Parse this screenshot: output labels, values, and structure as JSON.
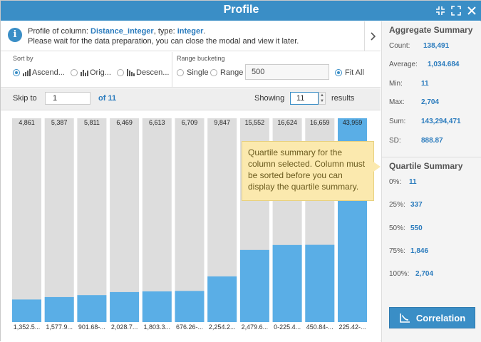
{
  "window": {
    "title": "Profile"
  },
  "info": {
    "prefix": "Profile of column: ",
    "column": "Distance_integer",
    "type_prefix": ", type: ",
    "type": "integer",
    "suffix": ".",
    "line2": "Please wait for the data preparation, you can close the modal and view it later."
  },
  "sort": {
    "label": "Sort by",
    "options": [
      "Ascend...",
      "Orig...",
      "Descen..."
    ]
  },
  "range": {
    "label": "Range bucketing",
    "single": "Single",
    "range": "Range",
    "value": "500",
    "fit": "Fit All"
  },
  "pager": {
    "skip_label": "Skip to",
    "skip_value": "1",
    "of_label": "of 11",
    "showing_label": "Showing",
    "showing_value": "11",
    "results_label": "results"
  },
  "tooltip": {
    "text": "Quartile summary for the column selected. Column must be sorted before you can display the quartile summary."
  },
  "aggregate": {
    "title": "Aggregate Summary",
    "rows": [
      {
        "label": "Count:",
        "value": "138,491"
      },
      {
        "label": "Average:",
        "value": "1,034.684"
      },
      {
        "label": "Min:",
        "value": "11"
      },
      {
        "label": "Max:",
        "value": "2,704"
      },
      {
        "label": "Sum:",
        "value": "143,294,471"
      },
      {
        "label": "SD:",
        "value": "888.87"
      }
    ]
  },
  "quartile": {
    "title": "Quartile Summary",
    "rows": [
      {
        "label": "0%:",
        "value": "11"
      },
      {
        "label": "25%:",
        "value": "337"
      },
      {
        "label": "50%:",
        "value": "550"
      },
      {
        "label": "75%:",
        "value": "1,846"
      },
      {
        "label": "100%:",
        "value": "2,704"
      }
    ]
  },
  "correlation_label": "Correlation",
  "colors": {
    "accent": "#3a8ec6",
    "bar": "#5aaee6",
    "bar_bg": "#dddddd",
    "tooltip": "#fbe9ae"
  },
  "chart_data": {
    "type": "bar",
    "categories": [
      "1,352.5...",
      "1,577.9...",
      "901.68-...",
      "2,028.7...",
      "1,803.3...",
      "676.26-...",
      "2,254.2...",
      "2,479.6...",
      "0-225.4...",
      "450.84-...",
      "225.42-..."
    ],
    "values": [
      4861,
      5387,
      5811,
      6469,
      6613,
      6709,
      9847,
      15552,
      16624,
      16659,
      43959
    ],
    "value_labels": [
      "4,861",
      "5,387",
      "5,811",
      "6,469",
      "6,613",
      "6,709",
      "9,847",
      "15,552",
      "16,624",
      "16,659",
      "43,959"
    ],
    "ylim": [
      0,
      43959
    ]
  }
}
